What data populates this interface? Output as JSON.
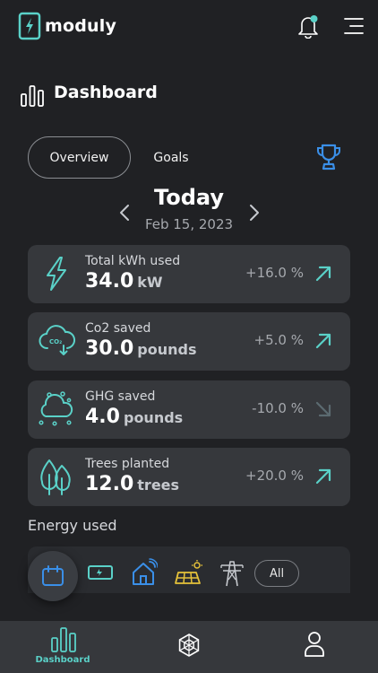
{
  "header": {
    "brand": "moduly",
    "logo_icon": "battery-bolt-icon",
    "notification_icon": "bell-icon",
    "menu_icon": "hamburger-menu-icon"
  },
  "page": {
    "title": "Dashboard",
    "title_icon": "bar-chart-icon"
  },
  "tabs": [
    {
      "label": "Overview",
      "active": true
    },
    {
      "label": "Goals",
      "active": false
    }
  ],
  "trophy_icon": "trophy-icon",
  "date_nav": {
    "title": "Today",
    "subtitle": "Feb 15, 2023"
  },
  "cards": [
    {
      "icon": "lightning-icon",
      "label": "Total kWh used",
      "value": "34.0",
      "unit": "kW",
      "change": "+16.0 %",
      "trend": "up"
    },
    {
      "icon": "co2-cloud-icon",
      "label": "Co2 saved",
      "value": "30.0",
      "unit": "pounds",
      "change": "+5.0 %",
      "trend": "up"
    },
    {
      "icon": "ghg-cloud-icon",
      "label": "GHG saved",
      "value": "4.0",
      "unit": "pounds",
      "change": "-10.0 %",
      "trend": "down"
    },
    {
      "icon": "trees-icon",
      "label": "Trees planted",
      "value": "12.0",
      "unit": "trees",
      "change": "+20.0 %",
      "trend": "up"
    }
  ],
  "energy": {
    "title": "Energy used",
    "filters": [
      "calendar-icon",
      "battery-icon",
      "smart-home-icon",
      "solar-panel-icon",
      "power-tower-icon"
    ],
    "all_label": "All"
  },
  "bottom_nav": {
    "items": [
      {
        "label": "Dashboard",
        "icon": "bar-chart-icon",
        "active": true
      },
      {
        "label": "",
        "icon": "network-icon",
        "active": false
      },
      {
        "label": "",
        "icon": "profile-icon",
        "active": false
      }
    ]
  },
  "colors": {
    "background": "#202124",
    "card": "#36383c",
    "accent": "#5ad1c8",
    "blue": "#3a8fe8",
    "yellow": "#e6c23a",
    "muted": "#a6a9ae"
  }
}
